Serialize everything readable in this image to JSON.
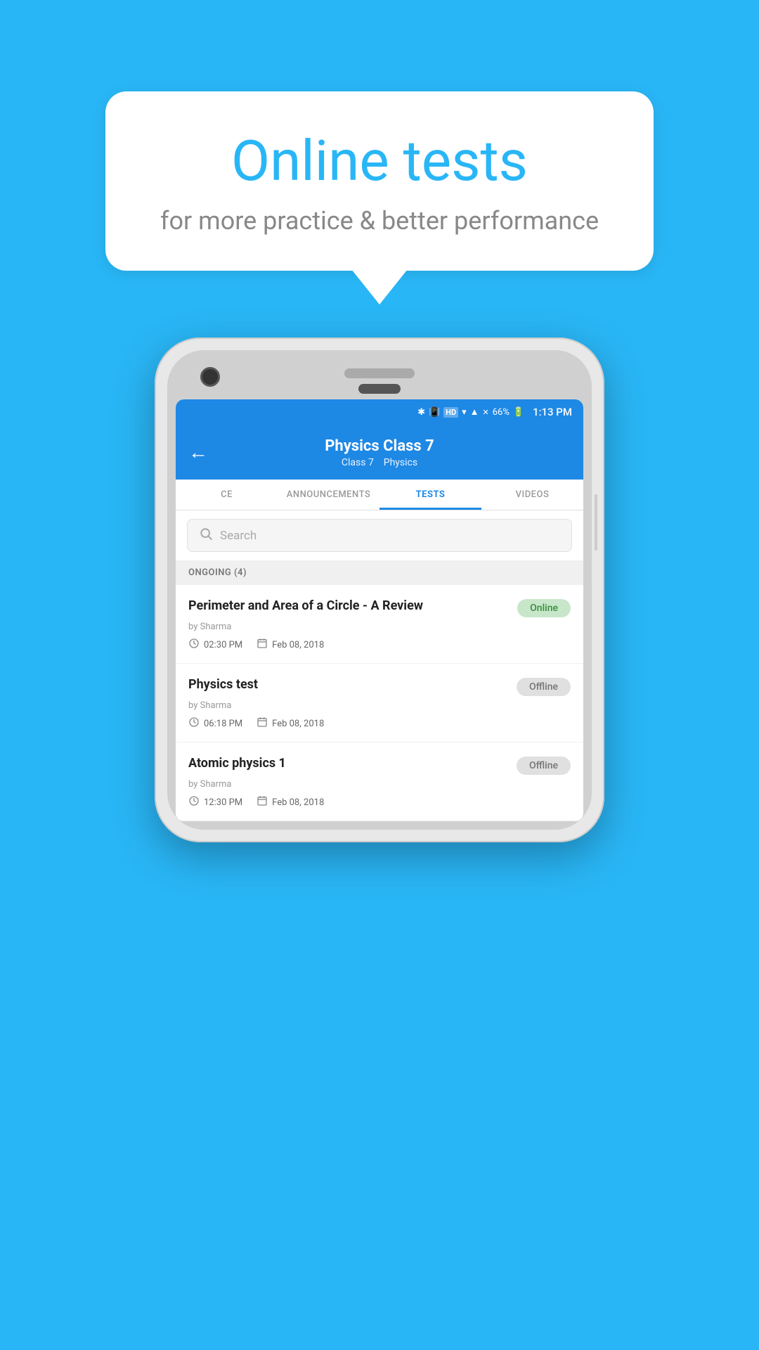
{
  "background": {
    "color": "#29b6f6"
  },
  "speech_bubble": {
    "title": "Online tests",
    "subtitle": "for more practice & better performance"
  },
  "status_bar": {
    "battery": "66%",
    "time": "1:13 PM",
    "signal_icons": "🔷📳HD▾✕✕"
  },
  "header": {
    "title": "Physics Class 7",
    "subtitle_class": "Class 7",
    "subtitle_subject": "Physics",
    "back_label": "←"
  },
  "tabs": [
    {
      "label": "CE",
      "active": false
    },
    {
      "label": "ANNOUNCEMENTS",
      "active": false
    },
    {
      "label": "TESTS",
      "active": true
    },
    {
      "label": "VIDEOS",
      "active": false
    }
  ],
  "search": {
    "placeholder": "Search"
  },
  "section": {
    "label": "ONGOING (4)"
  },
  "tests": [
    {
      "title": "Perimeter and Area of a Circle - A Review",
      "author": "by Sharma",
      "time": "02:30 PM",
      "date": "Feb 08, 2018",
      "status": "Online",
      "badge_type": "online"
    },
    {
      "title": "Physics test",
      "author": "by Sharma",
      "time": "06:18 PM",
      "date": "Feb 08, 2018",
      "status": "Offline",
      "badge_type": "offline"
    },
    {
      "title": "Atomic physics 1",
      "author": "by Sharma",
      "time": "12:30 PM",
      "date": "Feb 08, 2018",
      "status": "Offline",
      "badge_type": "offline"
    }
  ]
}
